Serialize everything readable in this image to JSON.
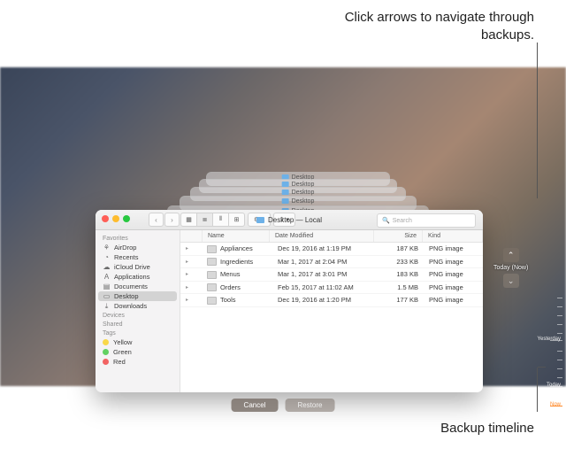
{
  "annotations": {
    "top": "Click arrows to navigate through backups.",
    "bottom": "Backup timeline"
  },
  "window": {
    "title_folder": "Desktop",
    "title_suffix": "— Local",
    "search_placeholder": "Search"
  },
  "toolbar": {
    "back": "‹",
    "forward": "›",
    "view_icons": [
      "▦",
      "≣",
      "⫴",
      "⊞"
    ],
    "arrange": "⚙ ▾",
    "share": "⇪ ▾"
  },
  "sidebar": {
    "favorites_head": "Favorites",
    "favorites": [
      {
        "icon": "⚘",
        "label": "AirDrop"
      },
      {
        "icon": "◔",
        "label": "Recents"
      },
      {
        "icon": "☁",
        "label": "iCloud Drive"
      },
      {
        "icon": "A",
        "label": "Applications"
      },
      {
        "icon": "▤",
        "label": "Documents"
      },
      {
        "icon": "▭",
        "label": "Desktop",
        "selected": true
      },
      {
        "icon": "⤓",
        "label": "Downloads"
      }
    ],
    "devices_head": "Devices",
    "shared_head": "Shared",
    "tags_head": "Tags",
    "tags": [
      {
        "cls": "ty",
        "label": "Yellow"
      },
      {
        "cls": "tg",
        "label": "Green"
      },
      {
        "cls": "tr",
        "label": "Red"
      }
    ]
  },
  "columns": {
    "name": "Name",
    "date": "Date Modified",
    "size": "Size",
    "kind": "Kind"
  },
  "files": [
    {
      "name": "Appliances",
      "date": "Dec 19, 2016 at 1:19 PM",
      "size": "187 KB",
      "kind": "PNG image"
    },
    {
      "name": "Ingredients",
      "date": "Mar 1, 2017 at 2:04 PM",
      "size": "233 KB",
      "kind": "PNG image"
    },
    {
      "name": "Menus",
      "date": "Mar 1, 2017 at 3:01 PM",
      "size": "183 KB",
      "kind": "PNG image"
    },
    {
      "name": "Orders",
      "date": "Feb 15, 2017 at 11:02 AM",
      "size": "1.5 MB",
      "kind": "PNG image"
    },
    {
      "name": "Tools",
      "date": "Dec 19, 2016 at 1:20 PM",
      "size": "177 KB",
      "kind": "PNG image"
    }
  ],
  "tm_nav": {
    "up": "⌃",
    "label": "Today (Now)",
    "down": "⌄"
  },
  "timeline": {
    "yesterday": "Yesterday",
    "today": "Today",
    "now": "Now"
  },
  "buttons": {
    "cancel": "Cancel",
    "restore": "Restore"
  }
}
